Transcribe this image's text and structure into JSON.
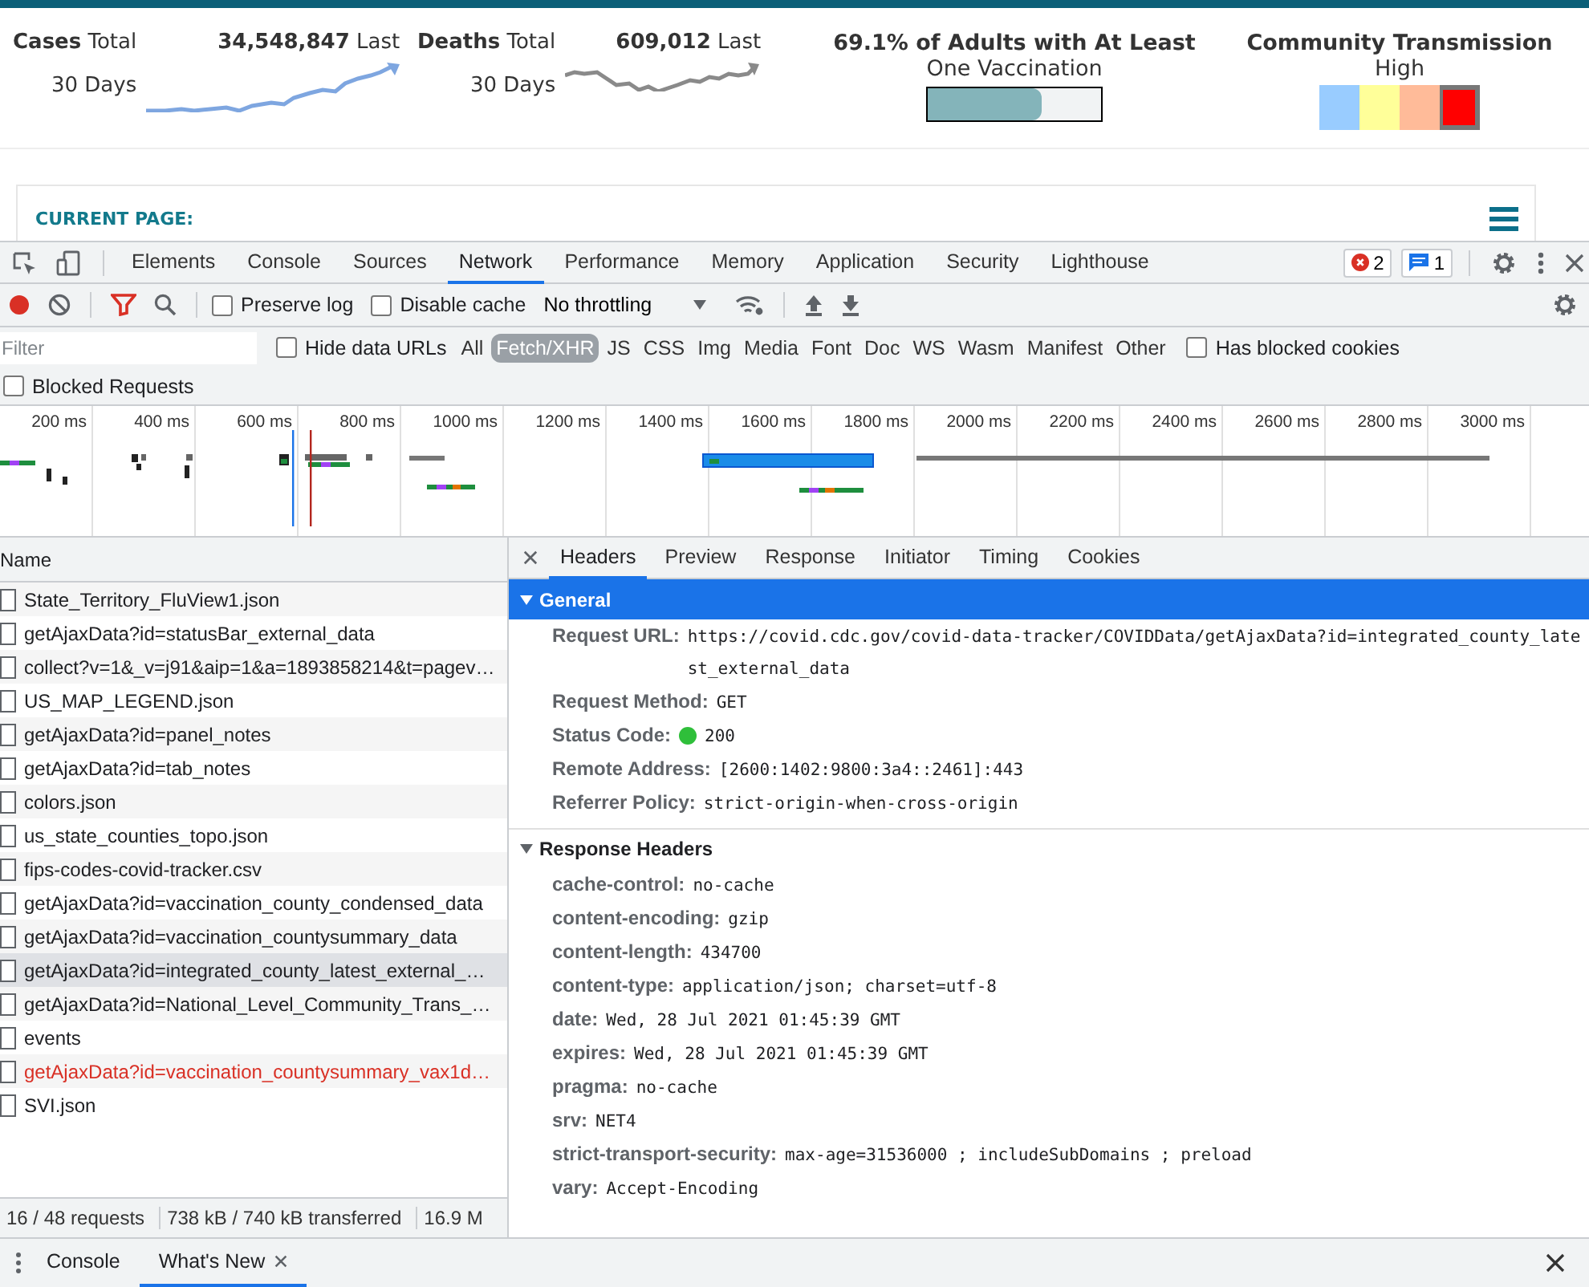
{
  "page": {
    "stats": [
      {
        "label": "**Cases** Total",
        "value": "**34,548,847** Last",
        "period": "30 Days",
        "color": "#7ea6e0"
      },
      {
        "label": "**Deaths** Total",
        "value": "**609,012** Last",
        "period": "30 Days",
        "color": "#8a8a8a"
      }
    ],
    "vaccination": {
      "title": "69.1% of Adults with At Least",
      "subtitle": "One Vaccination",
      "level": 0.66
    },
    "transmission": {
      "title": "Community Transmission",
      "value": "High",
      "levels": [
        {
          "color": "#99ccff",
          "selected": false
        },
        {
          "color": "#ffff99",
          "selected": false
        },
        {
          "color": "#ffbb99",
          "selected": false
        },
        {
          "color": "#ff0000",
          "selected": true
        }
      ]
    },
    "current_page": "CURRENT PAGE:"
  },
  "devtools": {
    "tabs": [
      {
        "label": "Elements",
        "selected": false
      },
      {
        "label": "Console",
        "selected": false
      },
      {
        "label": "Sources",
        "selected": false
      },
      {
        "label": "Network",
        "selected": true
      },
      {
        "label": "Performance",
        "selected": false
      },
      {
        "label": "Memory",
        "selected": false
      },
      {
        "label": "Application",
        "selected": false
      },
      {
        "label": "Security",
        "selected": false
      },
      {
        "label": "Lighthouse",
        "selected": false
      }
    ],
    "errors": "2",
    "messages": "1",
    "toolbar": {
      "checkboxes": [
        {
          "label": "Preserve log",
          "checked": false
        },
        {
          "label": "Disable cache",
          "checked": false
        }
      ],
      "throttling": "No throttling"
    },
    "filter": {
      "placeholder": "Filter",
      "hide_data_urls": {
        "label": "Hide data URLs",
        "checked": false
      },
      "types": [
        {
          "label": "All",
          "selected": false
        },
        {
          "label": "Fetch/XHR",
          "selected": true
        },
        {
          "label": "JS",
          "selected": false
        },
        {
          "label": "CSS",
          "selected": false
        },
        {
          "label": "Img",
          "selected": false
        },
        {
          "label": "Media",
          "selected": false
        },
        {
          "label": "Font",
          "selected": false
        },
        {
          "label": "Doc",
          "selected": false
        },
        {
          "label": "WS",
          "selected": false
        },
        {
          "label": "Wasm",
          "selected": false
        },
        {
          "label": "Manifest",
          "selected": false
        },
        {
          "label": "Other",
          "selected": false
        }
      ],
      "has_blocked_cookies": {
        "label": "Has blocked cookies",
        "checked": false
      },
      "blocked_requests": {
        "label": "Blocked Requests",
        "checked": false
      }
    },
    "timeline": {
      "ticks": [
        "200 ms",
        "400 ms",
        "600 ms",
        "800 ms",
        "1000 ms",
        "1200 ms",
        "1400 ms",
        "1600 ms",
        "1800 ms",
        "2000 ms",
        "2200 ms",
        "2400 ms",
        "2600 ms",
        "2800 ms",
        "3000 ms"
      ]
    },
    "requests": {
      "column": "Name",
      "rows": [
        {
          "name": "State_Territory_FluView1.json",
          "selected": false,
          "failed": false
        },
        {
          "name": "getAjaxData?id=statusBar_external_data",
          "selected": false,
          "failed": false
        },
        {
          "name": "collect?v=1&_v=j91&aip=1&a=1893858214&t=pagev…",
          "selected": false,
          "failed": false
        },
        {
          "name": "US_MAP_LEGEND.json",
          "selected": false,
          "failed": false
        },
        {
          "name": "getAjaxData?id=panel_notes",
          "selected": false,
          "failed": false
        },
        {
          "name": "getAjaxData?id=tab_notes",
          "selected": false,
          "failed": false
        },
        {
          "name": "colors.json",
          "selected": false,
          "failed": false
        },
        {
          "name": "us_state_counties_topo.json",
          "selected": false,
          "failed": false
        },
        {
          "name": "fips-codes-covid-tracker.csv",
          "selected": false,
          "failed": false
        },
        {
          "name": "getAjaxData?id=vaccination_county_condensed_data",
          "selected": false,
          "failed": false
        },
        {
          "name": "getAjaxData?id=vaccination_countysummary_data",
          "selected": false,
          "failed": false
        },
        {
          "name": "getAjaxData?id=integrated_county_latest_external_…",
          "selected": true,
          "failed": false
        },
        {
          "name": "getAjaxData?id=National_Level_Community_Trans_…",
          "selected": false,
          "failed": false
        },
        {
          "name": "events",
          "selected": false,
          "failed": false
        },
        {
          "name": "getAjaxData?id=vaccination_countysummary_vax1d…",
          "selected": false,
          "failed": true
        },
        {
          "name": "SVI.json",
          "selected": false,
          "failed": false
        }
      ],
      "summary": [
        "16 / 48 requests",
        "738 kB / 740 kB transferred",
        "16.9 M"
      ]
    },
    "details": {
      "tabs": [
        {
          "label": "Headers",
          "selected": true
        },
        {
          "label": "Preview",
          "selected": false
        },
        {
          "label": "Response",
          "selected": false
        },
        {
          "label": "Initiator",
          "selected": false
        },
        {
          "label": "Timing",
          "selected": false
        },
        {
          "label": "Cookies",
          "selected": false
        }
      ],
      "sections": [
        {
          "title": "General",
          "expanded": true,
          "selected": true,
          "fields": [
            {
              "name": "Request URL:",
              "value": "https://covid.cdc.gov/covid-data-tracker/COVIDData/getAjaxData?id=integrated_county_latest_external_data",
              "kind": "text"
            },
            {
              "name": "Request Method:",
              "value": "GET",
              "kind": "text"
            },
            {
              "name": "Status Code:",
              "value": "200",
              "kind": "status"
            },
            {
              "name": "Remote Address:",
              "value": "[2600:1402:9800:3a4::2461]:443",
              "kind": "text"
            },
            {
              "name": "Referrer Policy:",
              "value": "strict-origin-when-cross-origin",
              "kind": "text"
            }
          ]
        },
        {
          "title": "Response Headers",
          "expanded": true,
          "selected": false,
          "fields": [
            {
              "name": "cache-control:",
              "value": "no-cache",
              "kind": "text"
            },
            {
              "name": "content-encoding:",
              "value": "gzip",
              "kind": "text"
            },
            {
              "name": "content-length:",
              "value": "434700",
              "kind": "text"
            },
            {
              "name": "content-type:",
              "value": "application/json; charset=utf-8",
              "kind": "text"
            },
            {
              "name": "date:",
              "value": "Wed, 28 Jul 2021 01:45:39 GMT",
              "kind": "text"
            },
            {
              "name": "expires:",
              "value": "Wed, 28 Jul 2021 01:45:39 GMT",
              "kind": "text"
            },
            {
              "name": "pragma:",
              "value": "no-cache",
              "kind": "text"
            },
            {
              "name": "srv:",
              "value": "NET4",
              "kind": "text"
            },
            {
              "name": "strict-transport-security:",
              "value": "max-age=31536000 ; includeSubDomains ; preload",
              "kind": "text"
            },
            {
              "name": "vary:",
              "value": "Accept-Encoding",
              "kind": "text"
            }
          ]
        }
      ]
    }
  },
  "drawer": {
    "tabs": [
      {
        "label": "Console",
        "selected": false,
        "closable": false
      },
      {
        "label": "What's New",
        "selected": true,
        "closable": true
      }
    ]
  }
}
